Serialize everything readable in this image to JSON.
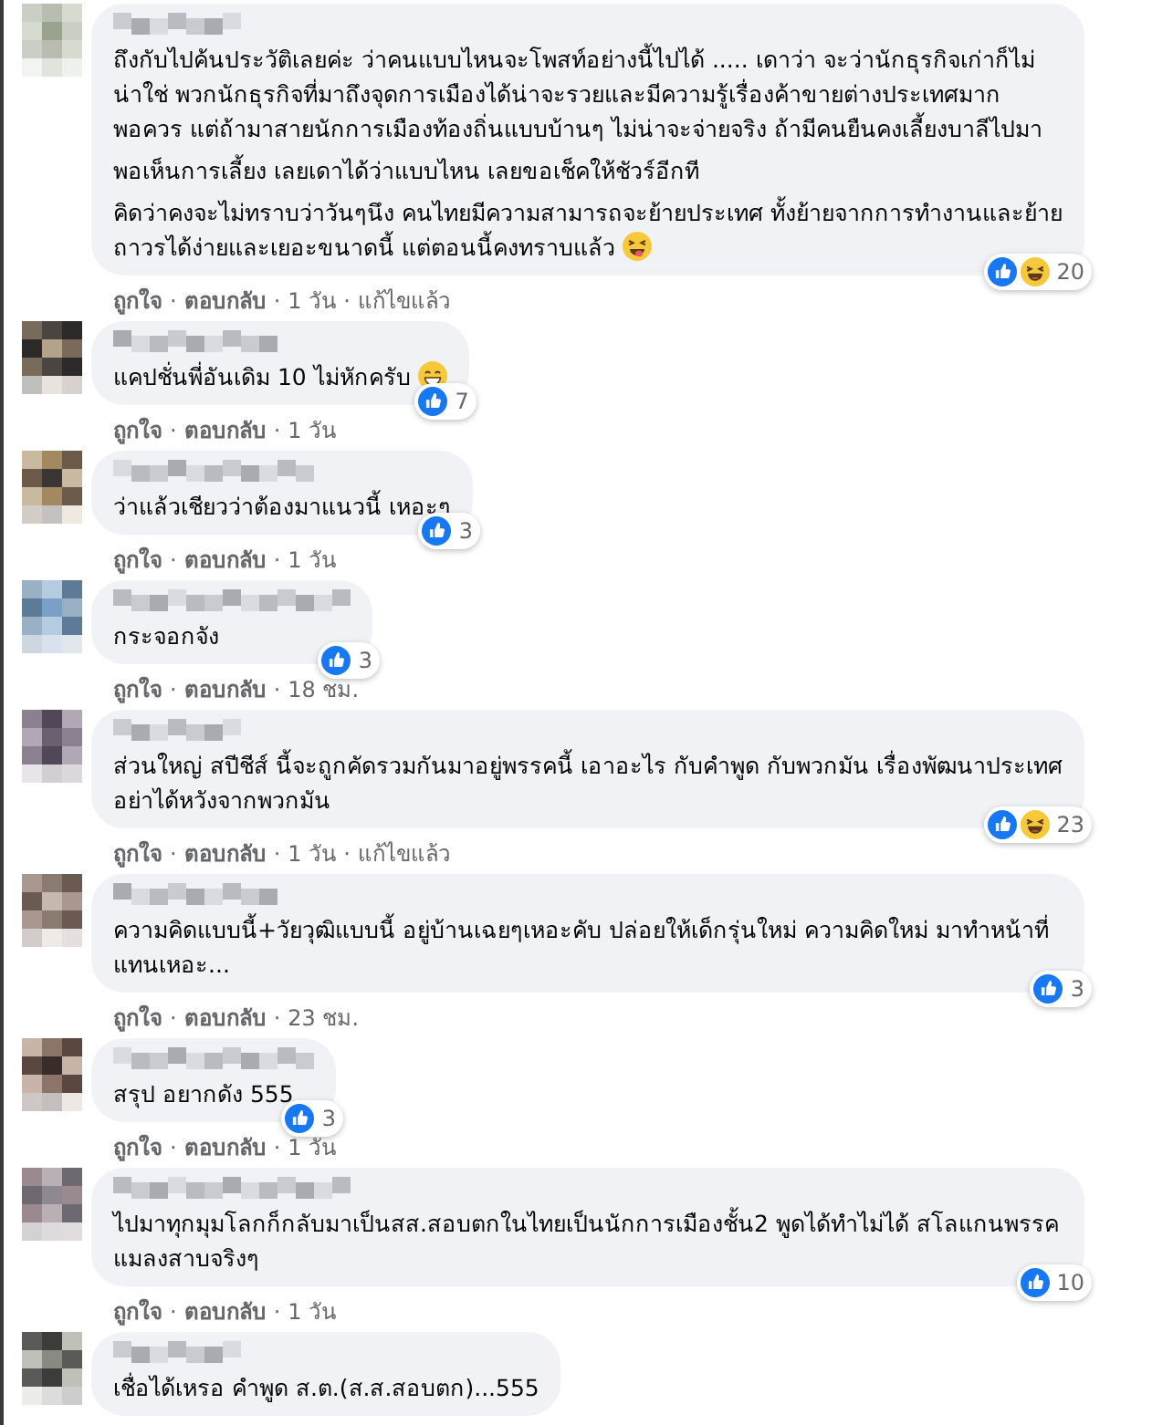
{
  "separator": "·",
  "comments": [
    {
      "paragraphs": [
        "ถึงกับไปค้นประวัติเลยค่ะ ว่าคนแบบไหนจะโพสท์อย่างนี้ไปได้ ..... เดาว่า จะว่านักธุรกิจเก่าก็ไม่น่าใช่ พวกนักธุรกิจที่มาถึงจุดการเมืองได้น่าจะรวยและมีความรู้เรื่องค้าขายต่างประเทศมากพอควร แต่ถ้ามาสายนักการเมืองท้องถิ่นแบบบ้านๆ ไม่น่าจะจ่ายจริง ถ้ามีคนยืนคงเลี้ยงบาลีไปมา",
        "พอเห็นการเลี้ยง เลยเดาได้ว่าแบบไหน เลยขอเช็คให้ชัวร์อีกที",
        "คิดว่าคงจะไม่ทราบว่าวันๆนึง คนไทยมีความสามารถจะย้ายประเทศ ทั้งย้ายจากการทำงานและย้ายถาวรได้ง่ายและเยอะขนาดนี้ แต่ตอนนี้คงทราบแล้ว"
      ],
      "trailing_emoji": {
        "kind": "tongue"
      },
      "reactions": [
        {
          "kind": "like"
        },
        {
          "kind": "haha"
        }
      ],
      "count": "20",
      "like": "ถูกใจ",
      "reply": "ตอบกลับ",
      "time": "1 วัน",
      "edited": "แก้ไขแล้ว"
    },
    {
      "paragraphs": [
        "แคปชั่นพี่อันเดิม 10 ไม่หักครับ"
      ],
      "trailing_emoji": {
        "kind": "grin"
      },
      "reactions": [
        {
          "kind": "like"
        }
      ],
      "count": "7",
      "like": "ถูกใจ",
      "reply": "ตอบกลับ",
      "time": "1 วัน"
    },
    {
      "paragraphs": [
        "ว่าแล้วเชียวว่าต้องมาแนวนี้ เหอะๆ"
      ],
      "reactions": [
        {
          "kind": "like"
        }
      ],
      "count": "3",
      "like": "ถูกใจ",
      "reply": "ตอบกลับ",
      "time": "1 วัน"
    },
    {
      "paragraphs": [
        "กระจอกจัง"
      ],
      "reactions": [
        {
          "kind": "like"
        }
      ],
      "count": "3",
      "like": "ถูกใจ",
      "reply": "ตอบกลับ",
      "time": "18 ชม."
    },
    {
      "paragraphs": [
        "ส่วนใหญ่ สปีชีส์ นี้จะถูกคัดรวมกันมาอยู่พรรคนี้ เอาอะไร กับคำพูด กับพวกมัน เรื่องพัฒนาประเทศ อย่าได้หวังจากพวกมัน"
      ],
      "reactions": [
        {
          "kind": "like"
        },
        {
          "kind": "haha"
        }
      ],
      "count": "23",
      "like": "ถูกใจ",
      "reply": "ตอบกลับ",
      "time": "1 วัน",
      "edited": "แก้ไขแล้ว"
    },
    {
      "paragraphs": [
        "ความคิดแบบนี้+วัยวุฒิแบบนี้ อยู่บ้านเฉยๆเหอะคับ ปล่อยให้เด็กรุ่นใหม่ ความคิดใหม่ มาทำหน้าที่แทนเหอะ..."
      ],
      "reactions": [
        {
          "kind": "like"
        }
      ],
      "count": "3",
      "like": "ถูกใจ",
      "reply": "ตอบกลับ",
      "time": "23 ชม."
    },
    {
      "paragraphs": [
        "สรุป อยากดัง 555"
      ],
      "reactions": [
        {
          "kind": "like"
        }
      ],
      "count": "3",
      "like": "ถูกใจ",
      "reply": "ตอบกลับ",
      "time": "1 วัน"
    },
    {
      "paragraphs": [
        "ไปมาทุกมุมโลกก็กลับมาเป็นสส.สอบตกในไทยเป็นนักการเมืองชั้น2 พูดได้ทำไม่ได้ สโลแกนพรรคแมลงสาบจริงๆ"
      ],
      "reactions": [
        {
          "kind": "like"
        }
      ],
      "count": "10",
      "like": "ถูกใจ",
      "reply": "ตอบกลับ",
      "time": "1 วัน"
    },
    {
      "paragraphs": [
        "เชื่อได้เหรอ คำพูด ส.ต.(ส.ส.สอบตก)...555"
      ]
    }
  ]
}
